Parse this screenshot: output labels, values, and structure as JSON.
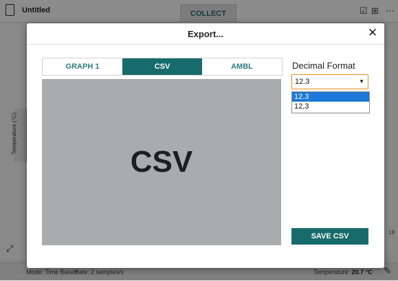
{
  "app": {
    "title": "Untitled",
    "collect_label": "COLLECT",
    "y_axis_label": "Temperature (°C)",
    "right_tick": "18",
    "status": {
      "mode": "Mode: Time Based",
      "rate": "Rate: 2 samples/s",
      "temp_label": "Temperature:",
      "temp_value": "20.7 °C"
    },
    "icons": {
      "document": "document-icon",
      "checkbox": "checkbox-icon",
      "layout": "layout-icon",
      "more": "more-icon",
      "chart": "chart-icon",
      "probe": "probe-icon"
    }
  },
  "modal": {
    "title": "Export...",
    "close_glyph": "✕",
    "tabs": [
      {
        "label": "GRAPH 1",
        "active": false
      },
      {
        "label": "CSV",
        "active": true
      },
      {
        "label": "AMBL",
        "active": false
      }
    ],
    "preview_text": "CSV",
    "format_label": "Decimal Format",
    "select_value": "12.3",
    "options": [
      {
        "label": "12.3",
        "selected": true
      },
      {
        "label": "12,3",
        "selected": false
      }
    ],
    "save_label": "SAVE CSV"
  },
  "colors": {
    "accent": "#186b6c",
    "focus": "#e08a1c",
    "highlight": "#1e78d7"
  }
}
